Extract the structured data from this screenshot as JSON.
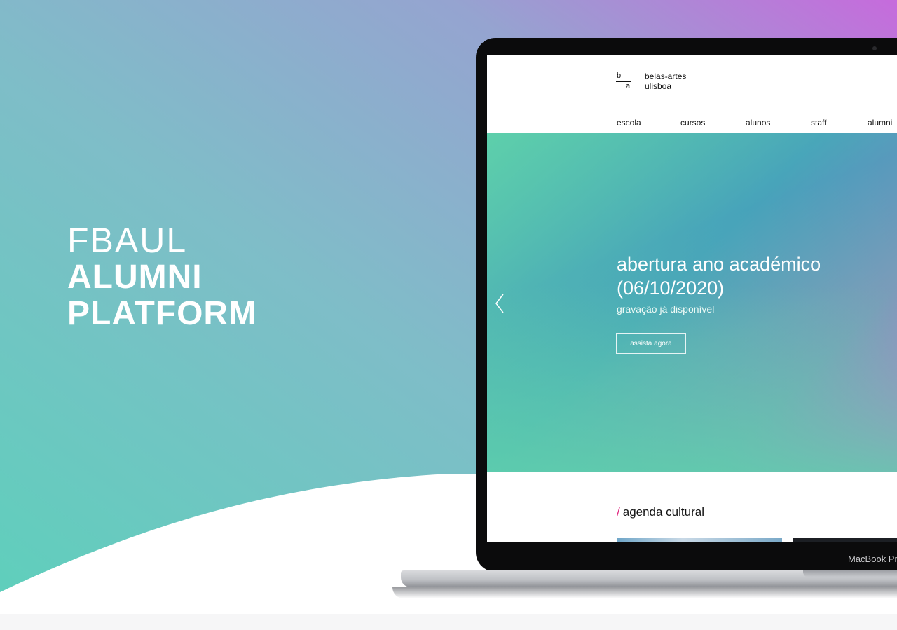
{
  "hero": {
    "line1": "FBAUL",
    "line2": "ALUMNI",
    "line3": "PLATFORM"
  },
  "colors": {
    "teal": "#66cdbd",
    "purple": "#c46ee0",
    "magenta_accent": "#e0237e"
  },
  "laptop": {
    "label": "MacBook Pro"
  },
  "site": {
    "logo": {
      "b": "b",
      "a": "a",
      "line1": "belas-artes",
      "line2": "ulisboa"
    },
    "nav": [
      "escola",
      "cursos",
      "alunos",
      "staff",
      "alumni"
    ],
    "slide": {
      "title": "abertura ano académico (06/10/2020)",
      "subtitle": "gravação já disponível",
      "button": "assista agora",
      "prev_icon": "chevron-left-icon"
    },
    "agenda": {
      "slash": "/",
      "title": "agenda cultural"
    }
  }
}
